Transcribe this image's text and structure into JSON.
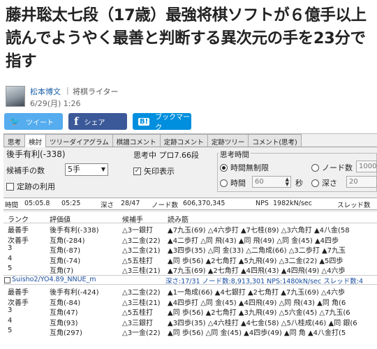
{
  "article": {
    "title": "藤井聡太七段（17歳）最強将棋ソフトが６億手以上読んでようやく最善と判断する異次元の手を23分で指す",
    "author": "松本博文",
    "separator": "|",
    "role": "将棋ライター",
    "date": "6/29(月) 1:26"
  },
  "share": {
    "twitter": {
      "icon": "🐦",
      "label": "ツイート",
      "icon_name": "twitter-icon"
    },
    "facebook": {
      "icon": "f",
      "label": "シェア",
      "icon_name": "facebook-icon"
    },
    "hatena": {
      "icon": "B!",
      "label": "ブックマーク",
      "icon_name": "hatena-bookmark-icon"
    },
    "colors": {
      "twitter": "#55acee",
      "facebook": "#3b5998",
      "hatena": "#008fde"
    }
  },
  "app": {
    "tabs": [
      "思考",
      "検討",
      "ツリーダイアグラム",
      "棋譜コメント",
      "定跡コメント",
      "定跡ツリー",
      "コメント(思考)"
    ],
    "active_tab": "検討",
    "status": "後手有利(-338)",
    "thinking_label": "思考中 プロ7.66段",
    "candidates_label": "候補手の数",
    "candidates_value": "5手",
    "show_arrows_label": "矢印表示",
    "show_arrows_checked": "✓",
    "use_joseki_label": "定跡の利用",
    "thinking_time_title": "思考時間",
    "radio_unlimited": "時間無制限",
    "radio_nodes": "ノード数",
    "nodes_value": "1000",
    "radio_time": "時間",
    "time_value": "60",
    "seconds_label": "秒",
    "radio_depth": "深さ",
    "depth_value": "20",
    "infobar": {
      "time_label": "時間",
      "time1": "05:05.8",
      "time2": "05:25",
      "depth_label": "深さ",
      "depth": "28/47",
      "nodes_label": "ノード数",
      "nodes": "606,370,345",
      "nps_label": "NPS",
      "nps": "1982kN/sec",
      "threads": "スレッド数"
    },
    "columns": [
      "ランク",
      "評価値",
      "候補手",
      "読み筋"
    ],
    "rows1": [
      {
        "rank": "最善手",
        "eval": "後手有利(-338)",
        "move": "△3一銀打",
        "line": "▲7九玉(69) △4六歩打 ▲7七桂(89) △3六角打 ▲4八金(58"
      },
      {
        "rank": "次善手",
        "eval": "互角(-284)",
        "move": "△3二金(22)",
        "line": "▲4二歩打 △同 飛(43) ▲同 飛(49) △同 金(45) ▲4四歩"
      },
      {
        "rank": "3",
        "eval": "互角(-87)",
        "move": "△3二金(21)",
        "line": "▲3四歩(35) △同 金(33) △二角成(66) △3二歩打 ▲7九玉"
      },
      {
        "rank": "4",
        "eval": "互角(-74)",
        "move": "△5五桂打",
        "line": "▲同 歩(56) ▲2七角打 ▲5九飛(49) △3二金(22) ▲5四歩"
      },
      {
        "rank": "5",
        "eval": "互角(7)",
        "move": "△3三桂(21)",
        "line": "▲7九玉(69) ▲2七角打 ▲4四飛(43) ▲4四飛(49) △4六歩"
      }
    ],
    "engine_line": "Suisho2/YO4.89_NNUE_m",
    "engine_stats": "深さ:17/31 ノード数:8,913,301 NPS:1480kN/sec スレッド数:4",
    "rows2": [
      {
        "rank": "最善手",
        "eval": "後手有利(-424)",
        "move": "△3二金(22)",
        "line": "▲1一角成(66) ▲4七銀打 ▲2七角打 ▲7九玉(69) △4六歩"
      },
      {
        "rank": "次善手",
        "eval": "互角(-84)",
        "move": "△3三桂(21)",
        "line": "▲4四歩打 △同 金(45) ▲4四飛(49) △同 飛(43) ▲同 角(6"
      },
      {
        "rank": "3",
        "eval": "互角(47)",
        "move": "△5五桂打",
        "line": "▲同 歩(56) ▲2七角打 ▲3九飛(49) △5六金(45) △7九玉(6"
      },
      {
        "rank": "4",
        "eval": "互角(93)",
        "move": "△3三銀打",
        "line": "▲3四歩(35) △4六桂打 ▲4七金(58) △5八桂成(46) ▲同 銀(6"
      },
      {
        "rank": "5",
        "eval": "互角(297)",
        "move": "△3一金(22)",
        "line": "▲同 歩(56) △同 金(45) ▲4四歩(49) ▲同 角 ▲4八金打(5"
      }
    ]
  }
}
